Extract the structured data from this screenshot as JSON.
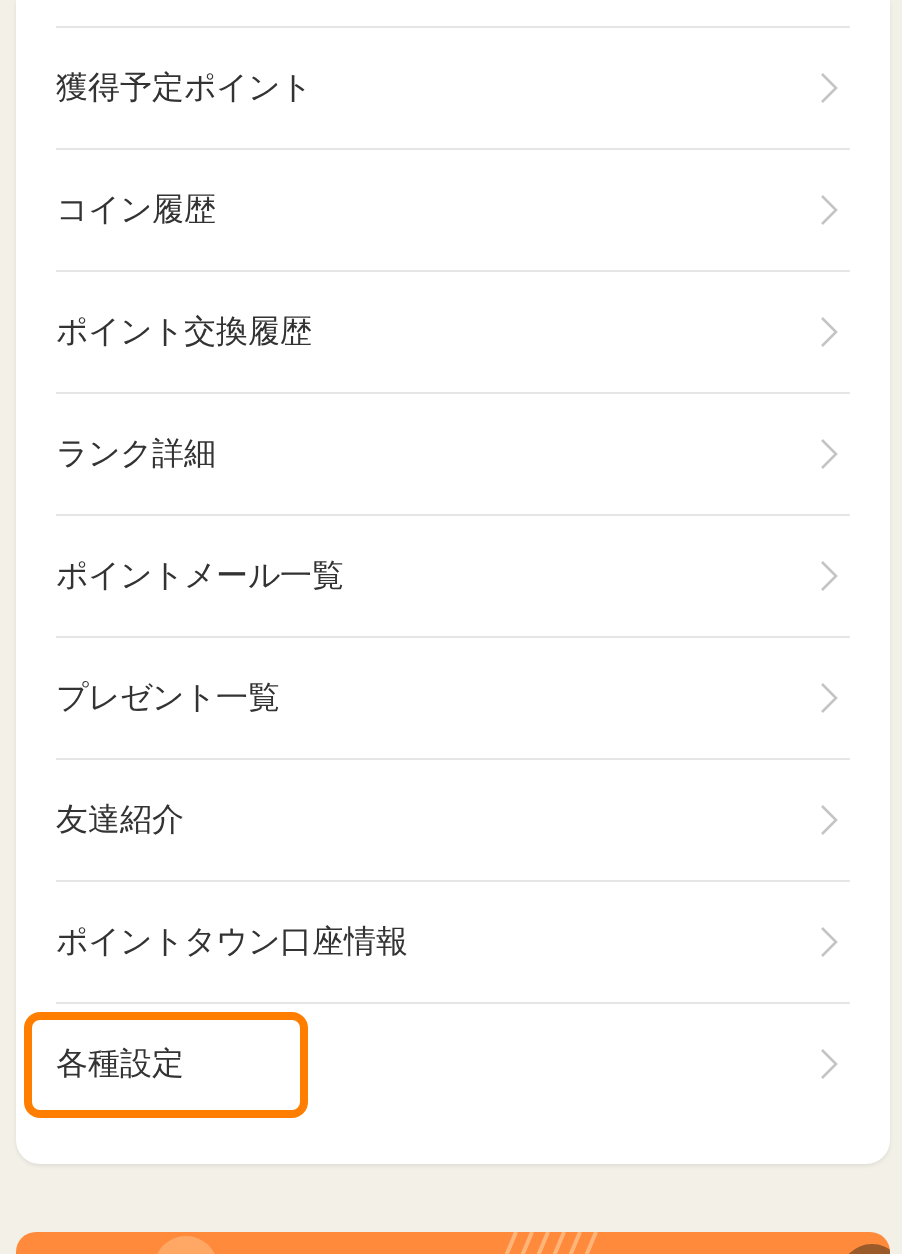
{
  "menu": {
    "items": [
      {
        "label": "獲得予定ポイント",
        "highlighted": false
      },
      {
        "label": "コイン履歴",
        "highlighted": false
      },
      {
        "label": "ポイント交換履歴",
        "highlighted": false
      },
      {
        "label": "ランク詳細",
        "highlighted": false
      },
      {
        "label": "ポイントメール一覧",
        "highlighted": false
      },
      {
        "label": "プレゼント一覧",
        "highlighted": false
      },
      {
        "label": "友達紹介",
        "highlighted": false
      },
      {
        "label": "ポイントタウン口座情報",
        "highlighted": false
      },
      {
        "label": "各種設定",
        "highlighted": true
      }
    ]
  }
}
